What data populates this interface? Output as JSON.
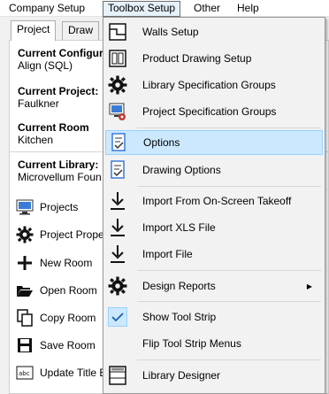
{
  "menubar": {
    "items": [
      "Company Setup",
      "Toolbox Setup",
      "Other",
      "Help"
    ]
  },
  "tabs": [
    "Project",
    "Draw"
  ],
  "panel": {
    "configuration": {
      "label": "Current Configur",
      "value": "Align (SQL)"
    },
    "project": {
      "label": "Current Project:",
      "value": "Faulkner"
    },
    "room": {
      "label": "Current Room",
      "value": "Kitchen"
    },
    "library": {
      "label": "Current Library:",
      "value": "Microvellum Foun"
    },
    "items": [
      {
        "label": "Projects",
        "icon": "projects-icon"
      },
      {
        "label": "Project Prope",
        "icon": "gear-icon"
      },
      {
        "label": "New Room",
        "icon": "plus-icon"
      },
      {
        "label": "Open Room",
        "icon": "open-folder-icon"
      },
      {
        "label": "Copy Room",
        "icon": "copy-icon"
      },
      {
        "label": "Save Room",
        "icon": "save-icon"
      },
      {
        "label": "Update Title B",
        "icon": "title-block-icon"
      }
    ]
  },
  "dropdown": {
    "items": [
      {
        "label": "Walls Setup",
        "icon": "walls-icon"
      },
      {
        "label": "Product Drawing Setup",
        "icon": "product-drawing-icon"
      },
      {
        "label": "Library Specification Groups",
        "icon": "gear-icon"
      },
      {
        "label": "Project Specification Groups",
        "icon": "project-spec-icon"
      },
      {
        "label": "Options",
        "icon": "options-icon"
      },
      {
        "label": "Drawing Options",
        "icon": "drawing-options-icon"
      },
      {
        "label": "Import From On-Screen Takeoff",
        "icon": "import-icon"
      },
      {
        "label": "Import XLS File",
        "icon": "import-icon"
      },
      {
        "label": "Import File",
        "icon": "import-icon"
      },
      {
        "label": "Design Reports",
        "icon": "gear-icon"
      },
      {
        "label": "Show Tool Strip",
        "icon": "checkmark-icon"
      },
      {
        "label": "Flip Tool Strip Menus",
        "icon": ""
      },
      {
        "label": "Library Designer",
        "icon": "library-designer-icon"
      }
    ]
  },
  "colors": {
    "highlight": "#cce8ff",
    "highlight_border": "#99d1ff",
    "menu_active": "#e5f1fb"
  }
}
